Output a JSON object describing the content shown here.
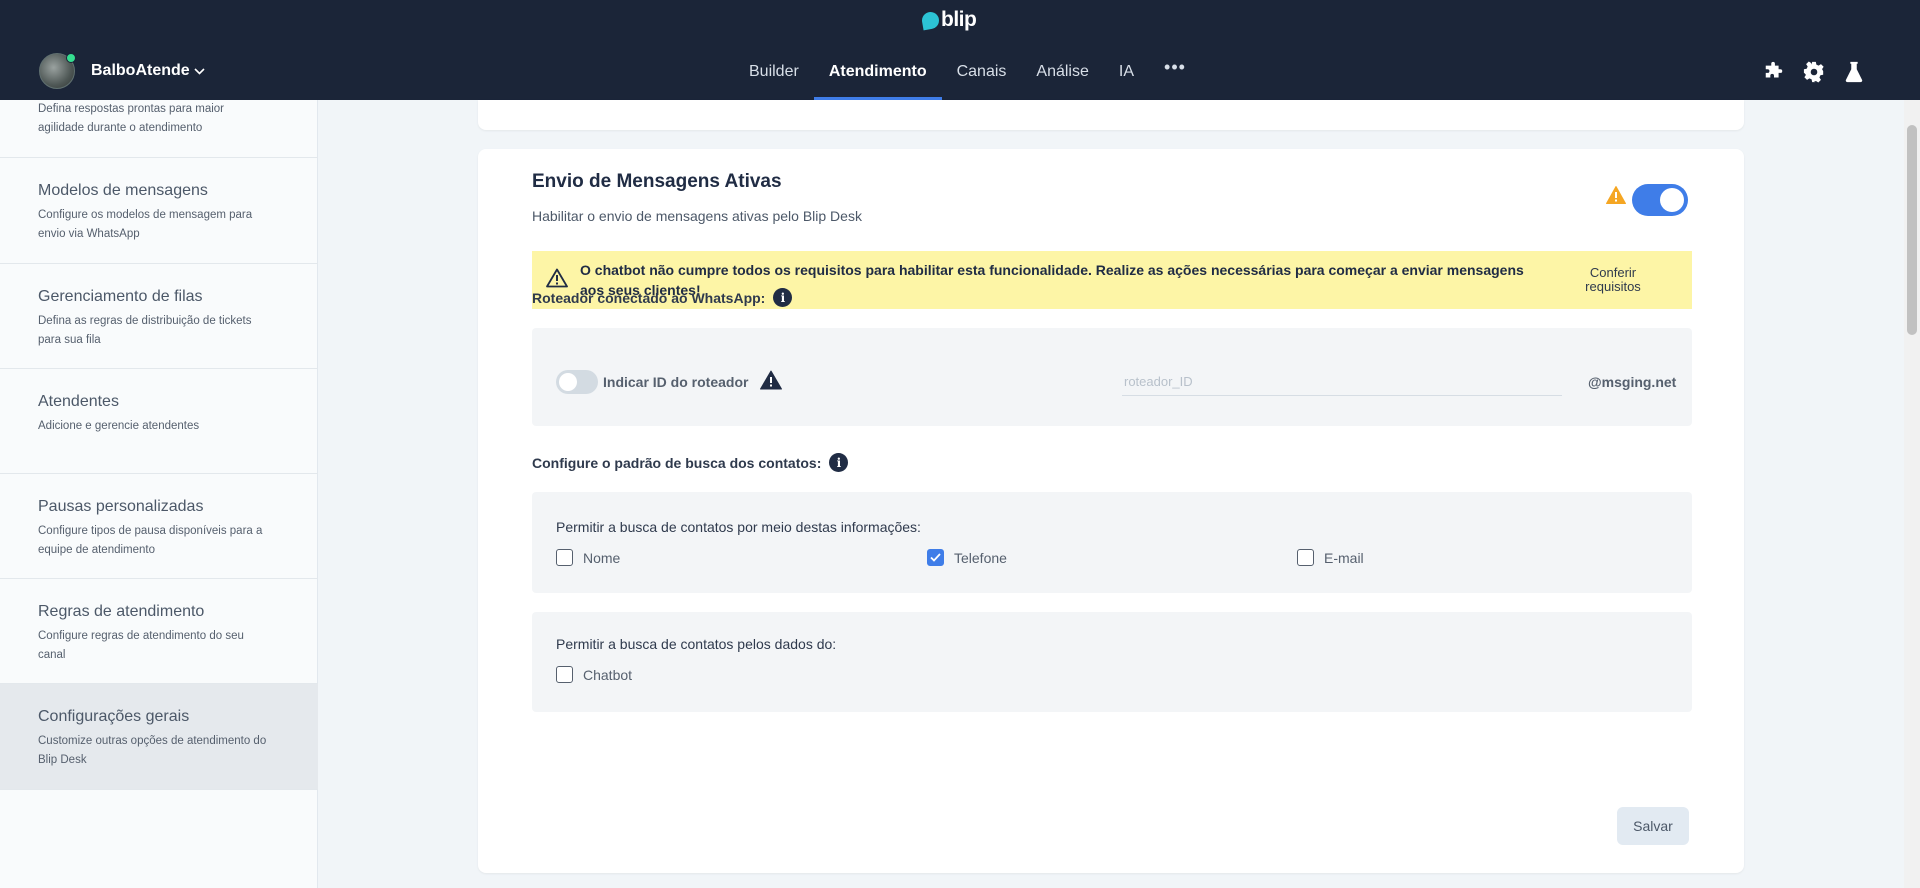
{
  "header": {
    "logo_text": "blip",
    "account_name": "BalboAtende",
    "tabs": [
      {
        "label": "Builder",
        "active": false
      },
      {
        "label": "Atendimento",
        "active": true
      },
      {
        "label": "Canais",
        "active": false
      },
      {
        "label": "Análise",
        "active": false
      },
      {
        "label": "IA",
        "active": false
      },
      {
        "label": "•••",
        "active": false
      }
    ],
    "icons": [
      "puzzle-icon",
      "gear-icon",
      "flask-icon"
    ]
  },
  "sidebar": {
    "items": [
      {
        "title": "",
        "desc": "Defina respostas prontas para maior agilidade durante o atendimento"
      },
      {
        "title": "Modelos de mensagens",
        "desc": "Configure os modelos de mensagem para envio via WhatsApp"
      },
      {
        "title": "Gerenciamento de filas",
        "desc": "Defina as regras de distribuição de tickets para sua fila"
      },
      {
        "title": "Atendentes",
        "desc": "Adicione e gerencie atendentes"
      },
      {
        "title": "Pausas personalizadas",
        "desc": "Configure tipos de pausa disponíveis para a equipe de atendimento"
      },
      {
        "title": "Regras de atendimento",
        "desc": "Configure regras de atendimento do seu canal"
      },
      {
        "title": "Configurações gerais",
        "desc": "Customize outras opções de atendimento do Blip Desk",
        "active": true
      }
    ]
  },
  "section": {
    "title": "Envio de Mensagens Ativas",
    "subtitle": "Habilitar o envio de mensagens ativas pelo Blip Desk",
    "enabled": true,
    "banner_text": "O chatbot não cumpre todos os requisitos para habilitar esta funcionalidade. Realize as ações necessárias para começar a enviar mensagens aos seus clientes!",
    "banner_link": "Conferir requisitos",
    "router_label": "Roteador conectado ao WhatsApp:",
    "router_toggle_label": "Indicar ID do roteador",
    "router_toggle_on": false,
    "router_placeholder": "roteador_ID",
    "router_value": "",
    "router_suffix": "@msging.net",
    "search_label": "Configure o padrão de busca dos contatos:",
    "search_info_title": "Permitir a busca de contatos por meio destas informações:",
    "search_options": [
      {
        "label": "Nome",
        "checked": false
      },
      {
        "label": "Telefone",
        "checked": true
      },
      {
        "label": "E-mail",
        "checked": false
      }
    ],
    "data_source_title": "Permitir a busca de contatos pelos dados do:",
    "data_source_options": [
      {
        "label": "Chatbot",
        "checked": false
      }
    ],
    "save_label": "Salvar"
  },
  "colors": {
    "header_bg": "#1b2538",
    "accent": "#3f7de8",
    "warning": "#f5a623",
    "banner_bg": "#fdf5a6",
    "online": "#35de90"
  }
}
